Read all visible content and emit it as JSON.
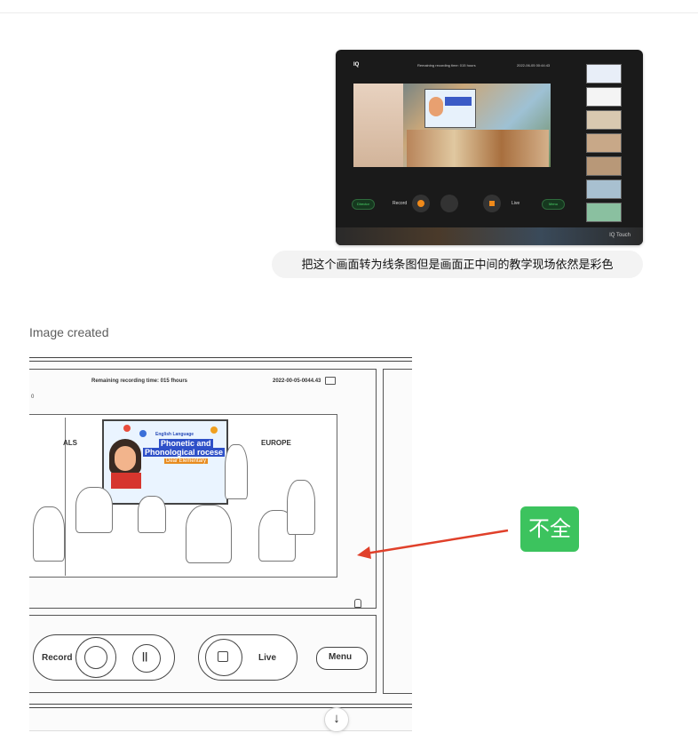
{
  "user_image": {
    "logo": "IQ",
    "remaining": "Remaining recording time: 015 hours",
    "date": "2022-06-05 00:44:43",
    "controls": {
      "director": "Director",
      "record": "Record",
      "live": "Live",
      "menu": "Menu"
    },
    "brand": "IQ Touch",
    "poster_left": "ALS",
    "poster_right": "EUROPE"
  },
  "user_message": "把这个画面转为线条图但是画面正中间的教学现场依然是彩色",
  "assistant": {
    "status": "Image created"
  },
  "generated_image": {
    "remaining": "Remaining recording time: 015 fhours",
    "date": "2022-00-05-0044.43",
    "top_left_glyph": "0",
    "poster": {
      "line1": "English Language",
      "line2": "Phonetic and",
      "line3": "Phonological rocese",
      "line4": "Dear Elementary"
    },
    "left_word": "ALS",
    "right_word": "EUROPE",
    "controls": {
      "record": "Record",
      "live": "Live",
      "menu": "Menu"
    }
  },
  "annotation": {
    "badge_text": "不全",
    "badge_color": "#3cc35e",
    "arrow_color": "#e0402a"
  },
  "scroll_down_icon": "↓"
}
